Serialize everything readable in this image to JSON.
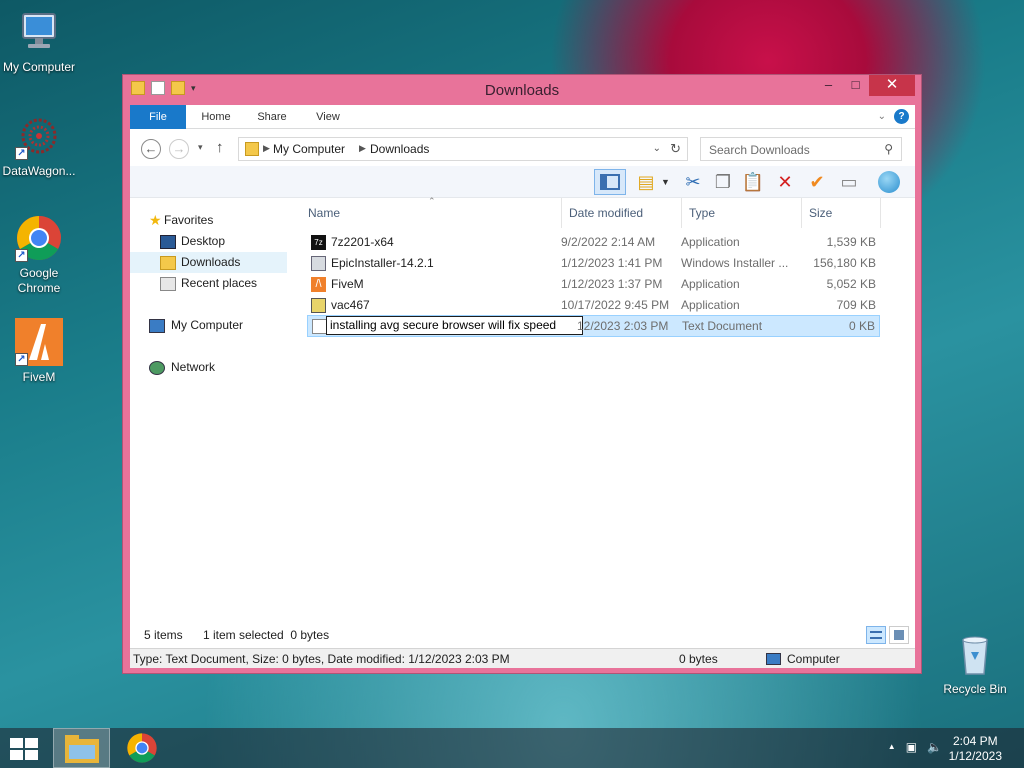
{
  "desktop": {
    "icons": [
      {
        "label": "My Computer",
        "icon": "monitor-icon"
      },
      {
        "label": "DataWagon...",
        "icon": "molecule-icon"
      },
      {
        "label": "Google Chrome",
        "icon": "chrome-icon"
      },
      {
        "label": "FiveM",
        "icon": "fivem-icon"
      },
      {
        "label": "Recycle Bin",
        "icon": "recycle-bin-icon"
      }
    ]
  },
  "window": {
    "title": "Downloads",
    "buttons": {
      "minimize": "–",
      "maximize": "□",
      "close": "✕"
    },
    "ribbon": {
      "tabs": [
        "File",
        "Home",
        "Share",
        "View"
      ],
      "help": "?"
    },
    "address": {
      "segments": [
        "My Computer",
        "Downloads"
      ],
      "search_placeholder": "Search Downloads"
    },
    "nav_pane": {
      "favorites_label": "Favorites",
      "favorites": [
        "Desktop",
        "Downloads",
        "Recent places"
      ],
      "selected": "Downloads",
      "computer_label": "My Computer",
      "network_label": "Network"
    },
    "columns": [
      "Name",
      "Date modified",
      "Type",
      "Size"
    ],
    "files": [
      {
        "name": "7z2201-x64",
        "date": "9/2/2022 2:14 AM",
        "type": "Application",
        "size": "1,539 KB",
        "icon": "7zip-icon"
      },
      {
        "name": "EpicInstaller-14.2.1",
        "date": "1/12/2023 1:41 PM",
        "type": "Windows Installer ...",
        "size": "156,180 KB",
        "icon": "msi-installer-icon"
      },
      {
        "name": "FiveM",
        "date": "1/12/2023 1:37 PM",
        "type": "Application",
        "size": "5,052 KB",
        "icon": "fivem-icon"
      },
      {
        "name": "vac467",
        "date": "10/17/2022 9:45 PM",
        "type": "Application",
        "size": "709 KB",
        "icon": "app-icon"
      },
      {
        "name": "installing avg secure browser will fix speed",
        "date": "1/12/2023 2:03 PM",
        "date_visible": "12/2023 2:03 PM",
        "type": "Text Document",
        "size": "0 KB",
        "icon": "text-document-icon",
        "renaming": true
      }
    ],
    "status": {
      "items": "5 items",
      "selected": "1 item selected  0 bytes"
    },
    "details": {
      "text": "Type: Text Document, Size: 0 bytes, Date modified: 1/12/2023 2:03 PM",
      "size": "0 bytes",
      "location": "Computer"
    }
  },
  "taskbar": {
    "time": "2:04 PM",
    "date": "1/12/2023",
    "tray_arrow": "▲"
  },
  "colors": {
    "window_frame": "#e8739a",
    "file_tab": "#1979ca",
    "close_button": "#c7344a",
    "selection": "#cce8ff"
  }
}
